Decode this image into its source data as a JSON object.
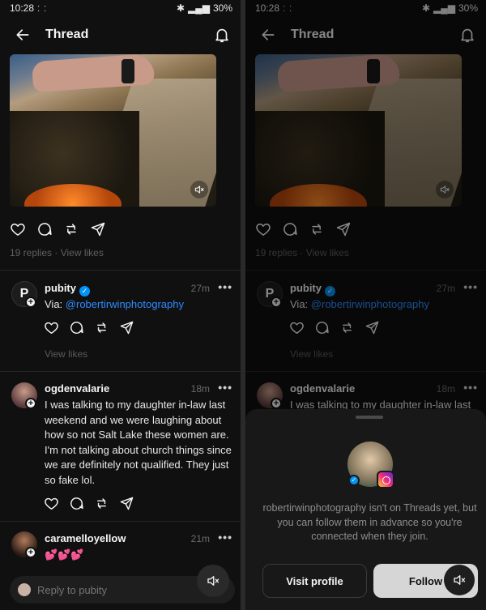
{
  "status": {
    "time": "10:28",
    "dots": "⁚ ⁚",
    "battery": "30%"
  },
  "header": {
    "title": "Thread"
  },
  "post": {
    "stats": "19 replies · View likes"
  },
  "replies": [
    {
      "username": "pubity",
      "time": "27m",
      "via_prefix": "Via:",
      "via_mention": "@robertirwinphotography",
      "view_likes": "View likes"
    },
    {
      "username": "ogdenvalarie",
      "time": "18m",
      "text": "I was talking to my daughter in-law last weekend and we were laughing about how so not Salt Lake these women are. I'm not talking about church things since we are definitely not qualified. They just so fake lol."
    },
    {
      "username": "caramelloyellow",
      "time": "21m",
      "text": "💕💕💕"
    }
  ],
  "composer": {
    "placeholder": "Reply to pubity"
  },
  "sheet": {
    "message": "robertirwinphotography isn't on Threads yet, but you can follow them in advance so you're connected when they join.",
    "visit_label": "Visit profile",
    "follow_label": "Follow"
  },
  "right": {
    "reply2_snippet": "I was talking to my daughter in-law last"
  },
  "icons": {
    "back": "back-arrow-icon",
    "bell": "bell-icon",
    "like": "heart-icon",
    "comment": "comment-icon",
    "repost": "repost-icon",
    "share": "send-icon",
    "mute": "speaker-muted-icon"
  },
  "colors": {
    "background": "#101010",
    "link": "#2f8cff",
    "verified": "#0095f6"
  }
}
